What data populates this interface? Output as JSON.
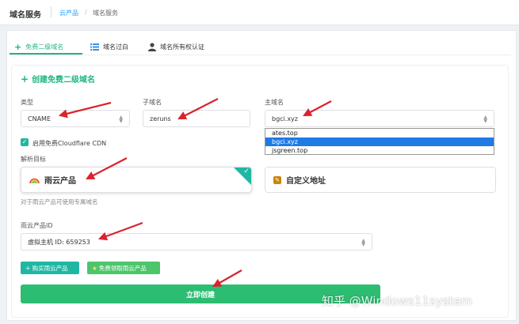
{
  "header": {
    "title": "域名服务",
    "breadcrumb": [
      "云产品",
      "域名服务"
    ],
    "separator": "/"
  },
  "tabs": [
    {
      "label": "免费二级域名",
      "icon": "plus-icon",
      "active": true
    },
    {
      "label": "域名过白",
      "icon": "list-icon",
      "active": false
    },
    {
      "label": "域名所有权认证",
      "icon": "user-icon",
      "active": false
    }
  ],
  "form": {
    "section_title": "创建免费二级域名",
    "type": {
      "label": "类型",
      "value": "CNAME"
    },
    "subdomain": {
      "label": "子域名",
      "value": "zeruns"
    },
    "main_domain": {
      "label": "主域名",
      "value": "bgci.xyz",
      "options": [
        "ates.top",
        "bgci.xyz",
        "jsgreen.top"
      ],
      "selected_index": 1
    },
    "cdn_checkbox": {
      "label": "启用免费Cloudflare CDN",
      "checked": true
    },
    "target": {
      "label": "解析目标",
      "options": [
        {
          "label": "雨云产品",
          "icon": "rainbow-icon",
          "selected": true
        },
        {
          "label": "自定义地址",
          "icon": "custom-address-icon",
          "selected": false
        }
      ],
      "hint": "对于雨云产品可使用专属域名"
    },
    "product_id": {
      "label": "雨云产品ID",
      "value": "虚拟主机 ID: 659253"
    },
    "buttons": {
      "buy": "+ 购买雨云产品",
      "free": "免费领取雨云产品",
      "create": "立即创建"
    }
  },
  "watermark": "知乎 @Windows11system",
  "colors": {
    "accent": "#1fb77e",
    "teal": "#1fb7a3",
    "primary_button": "#2dbd72",
    "link": "#1e9fff",
    "annotation_arrow": "#d9232d",
    "dropdown_highlight": "#1e7be6"
  }
}
